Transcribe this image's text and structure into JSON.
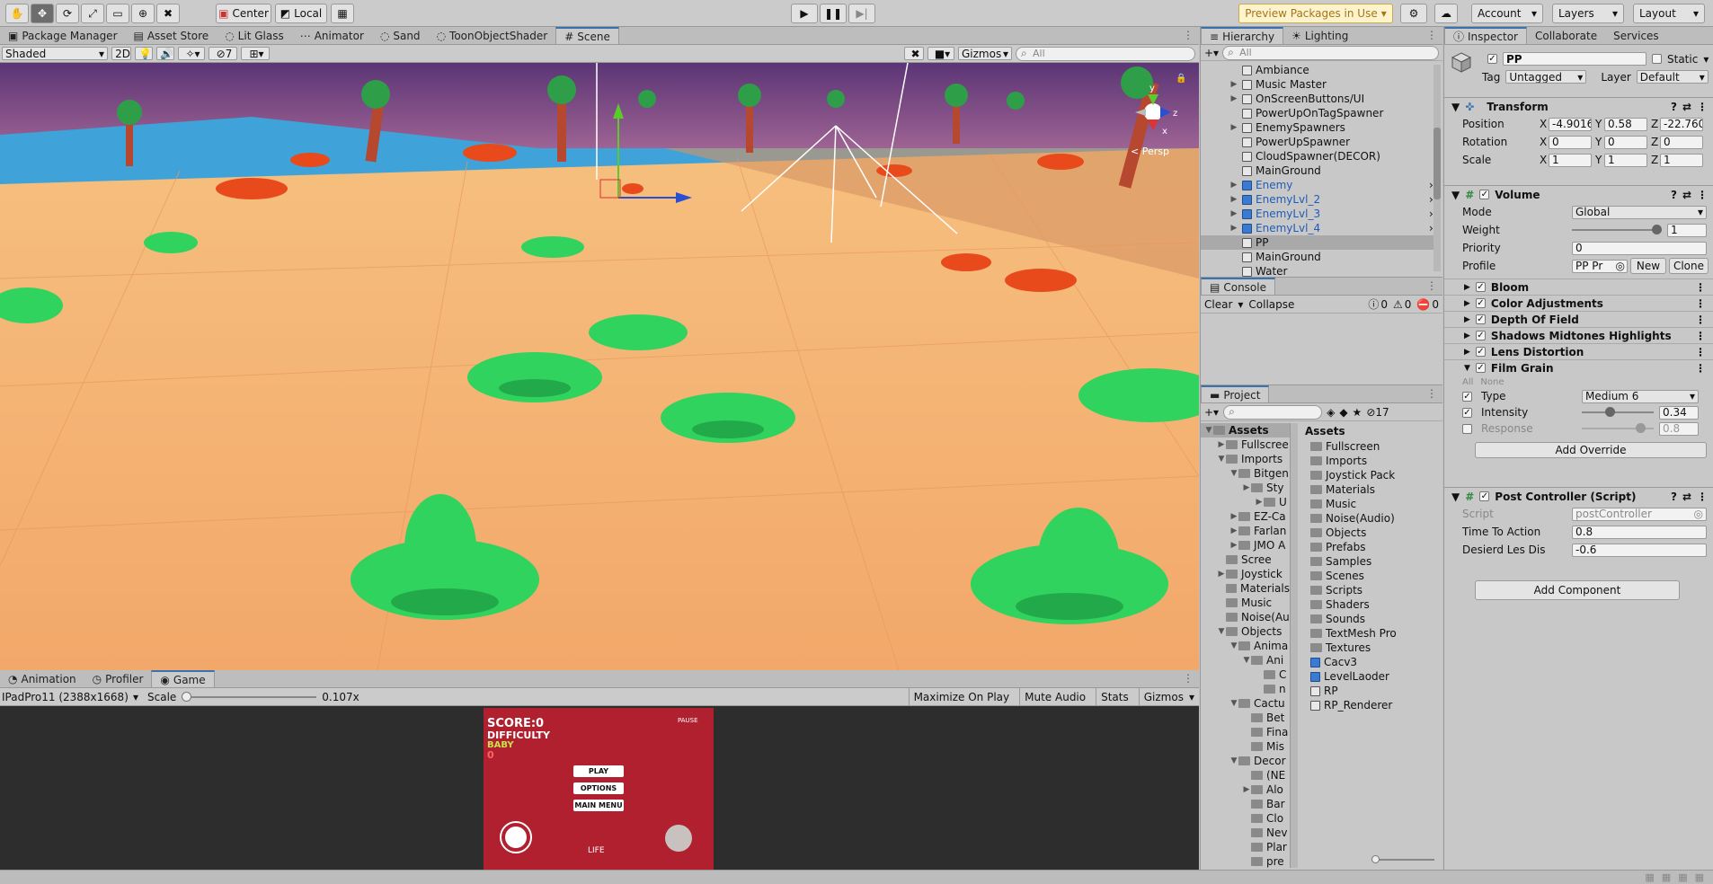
{
  "toolbar": {
    "center_label": "Center",
    "local_label": "Local",
    "preview_packages": "Preview Packages in Use",
    "account": "Account",
    "layers": "Layers",
    "layout": "Layout"
  },
  "scene_tabs": [
    "Package Manager",
    "Asset Store",
    "Lit Glass",
    "Animator",
    "Sand",
    "ToonObjectShader",
    "Scene"
  ],
  "scene_toolbar": {
    "shading": "Shaded",
    "mode_2d": "2D",
    "hidden_count": "7",
    "gizmos": "Gizmos",
    "search_placeholder": "All",
    "persp": "< Persp"
  },
  "hierarchy": {
    "tabs": [
      "Hierarchy",
      "Lighting"
    ],
    "search_placeholder": "All",
    "items": [
      {
        "label": "Ambiance",
        "arrow": false,
        "blue": false
      },
      {
        "label": "Music Master",
        "arrow": true,
        "blue": false
      },
      {
        "label": "OnScreenButtons/UI",
        "arrow": true,
        "blue": false
      },
      {
        "label": "PowerUpOnTagSpawner",
        "arrow": false,
        "blue": false
      },
      {
        "label": "EnemySpawners",
        "arrow": true,
        "blue": false
      },
      {
        "label": "PowerUpSpawner",
        "arrow": false,
        "blue": false
      },
      {
        "label": "CloudSpawner(DECOR)",
        "arrow": false,
        "blue": false
      },
      {
        "label": "MainGround",
        "arrow": false,
        "blue": false
      },
      {
        "label": "Enemy",
        "arrow": true,
        "blue": true
      },
      {
        "label": "EnemyLvl_2",
        "arrow": true,
        "blue": true
      },
      {
        "label": "EnemyLvl_3",
        "arrow": true,
        "blue": true
      },
      {
        "label": "EnemyLvl_4",
        "arrow": true,
        "blue": true
      },
      {
        "label": "PP",
        "arrow": false,
        "blue": false
      },
      {
        "label": "MainGround",
        "arrow": false,
        "blue": false
      },
      {
        "label": "Water",
        "arrow": false,
        "blue": false
      }
    ]
  },
  "console": {
    "tab": "Console",
    "clear": "Clear",
    "collapse": "Collapse",
    "info_count": "0",
    "warn_count": "0",
    "error_count": "0"
  },
  "project": {
    "tab": "Project",
    "hidden_count": "17",
    "tree": [
      "Assets",
      "Fullscree",
      "Imports",
      "Bitgen",
      "Sty",
      "U",
      "EZ-Ca",
      "Farlan",
      "JMO A",
      "Scree",
      "Joystick",
      "Materials",
      "Music",
      "Noise(Au",
      "Objects",
      "Anima",
      "Ani",
      "C",
      "n",
      "Cactu",
      "Bet",
      "Fina",
      "Mis",
      "Decor",
      "(NE",
      "Alo",
      "Bar",
      "Clo",
      "Nev",
      "Plar",
      "pre"
    ],
    "assets_header": "Assets",
    "assets": [
      {
        "label": "Fullscreen",
        "kind": "folder"
      },
      {
        "label": "Imports",
        "kind": "folder"
      },
      {
        "label": "Joystick Pack",
        "kind": "folder"
      },
      {
        "label": "Materials",
        "kind": "folder"
      },
      {
        "label": "Music",
        "kind": "folder"
      },
      {
        "label": "Noise(Audio)",
        "kind": "folder"
      },
      {
        "label": "Objects",
        "kind": "folder"
      },
      {
        "label": "Prefabs",
        "kind": "folder"
      },
      {
        "label": "Samples",
        "kind": "folder"
      },
      {
        "label": "Scenes",
        "kind": "folder"
      },
      {
        "label": "Scripts",
        "kind": "folder"
      },
      {
        "label": "Shaders",
        "kind": "folder"
      },
      {
        "label": "Sounds",
        "kind": "folder"
      },
      {
        "label": "TextMesh Pro",
        "kind": "folder"
      },
      {
        "label": "Textures",
        "kind": "folder"
      },
      {
        "label": "Cacv3",
        "kind": "prefab"
      },
      {
        "label": "LevelLaoder",
        "kind": "prefab"
      },
      {
        "label": "RP",
        "kind": "asset"
      },
      {
        "label": "RP_Renderer",
        "kind": "asset"
      }
    ]
  },
  "inspector": {
    "tabs": [
      "Inspector",
      "Collaborate",
      "Services"
    ],
    "object_name": "PP",
    "static_label": "Static",
    "tag_label": "Tag",
    "tag_value": "Untagged",
    "layer_label": "Layer",
    "layer_value": "Default",
    "transform": {
      "title": "Transform",
      "position_label": "Position",
      "rotation_label": "Rotation",
      "scale_label": "Scale",
      "position": [
        "-4.9016",
        "0.58",
        "-22.760"
      ],
      "rotation": [
        "0",
        "0",
        "0"
      ],
      "scale": [
        "1",
        "1",
        "1"
      ]
    },
    "volume": {
      "title": "Volume",
      "mode_label": "Mode",
      "mode_value": "Global",
      "weight_label": "Weight",
      "weight_value": "1",
      "priority_label": "Priority",
      "priority_value": "0",
      "profile_label": "Profile",
      "profile_value": "PP Pr",
      "new_btn": "New",
      "clone_btn": "Clone",
      "overrides": [
        "Bloom",
        "Color Adjustments",
        "Depth Of Field",
        "Shadows Midtones Highlights",
        "Lens Distortion",
        "Film Grain"
      ],
      "all": "All",
      "none": "None",
      "type_label": "Type",
      "type_value": "Medium 6",
      "intensity_label": "Intensity",
      "intensity_value": "0.34",
      "response_label": "Response",
      "response_value": "0.8",
      "add_override": "Add Override"
    },
    "post_controller": {
      "title": "Post Controller (Script)",
      "script_label": "Script",
      "script_value": "postController",
      "time_label": "Time To Action",
      "time_value": "0.8",
      "dist_label": "Desierd Les Dis",
      "dist_value": "-0.6"
    },
    "add_component": "Add Component"
  },
  "game": {
    "tabs": [
      "Animation",
      "Profiler",
      "Game"
    ],
    "resolution": "IPadPro11 (2388x1668)",
    "scale_label": "Scale",
    "scale_value": "0.107x",
    "maximize": "Maximize On Play",
    "mute": "Mute Audio",
    "stats": "Stats",
    "gizmos": "Gizmos",
    "score": "SCORE:0",
    "difficulty": "DIFFICULTY",
    "baby": "BABY",
    "zero": "0",
    "pause": "PAUSE",
    "play": "PLAY",
    "options": "OPTIONS",
    "main_menu": "MAIN MENU",
    "life": "LIFE"
  },
  "colors": {
    "accent": "#3a72b0",
    "game_bg": "#b0202f",
    "sand": "#f3b074",
    "sky": "#6a3d7e",
    "plant": "#2ec954"
  }
}
